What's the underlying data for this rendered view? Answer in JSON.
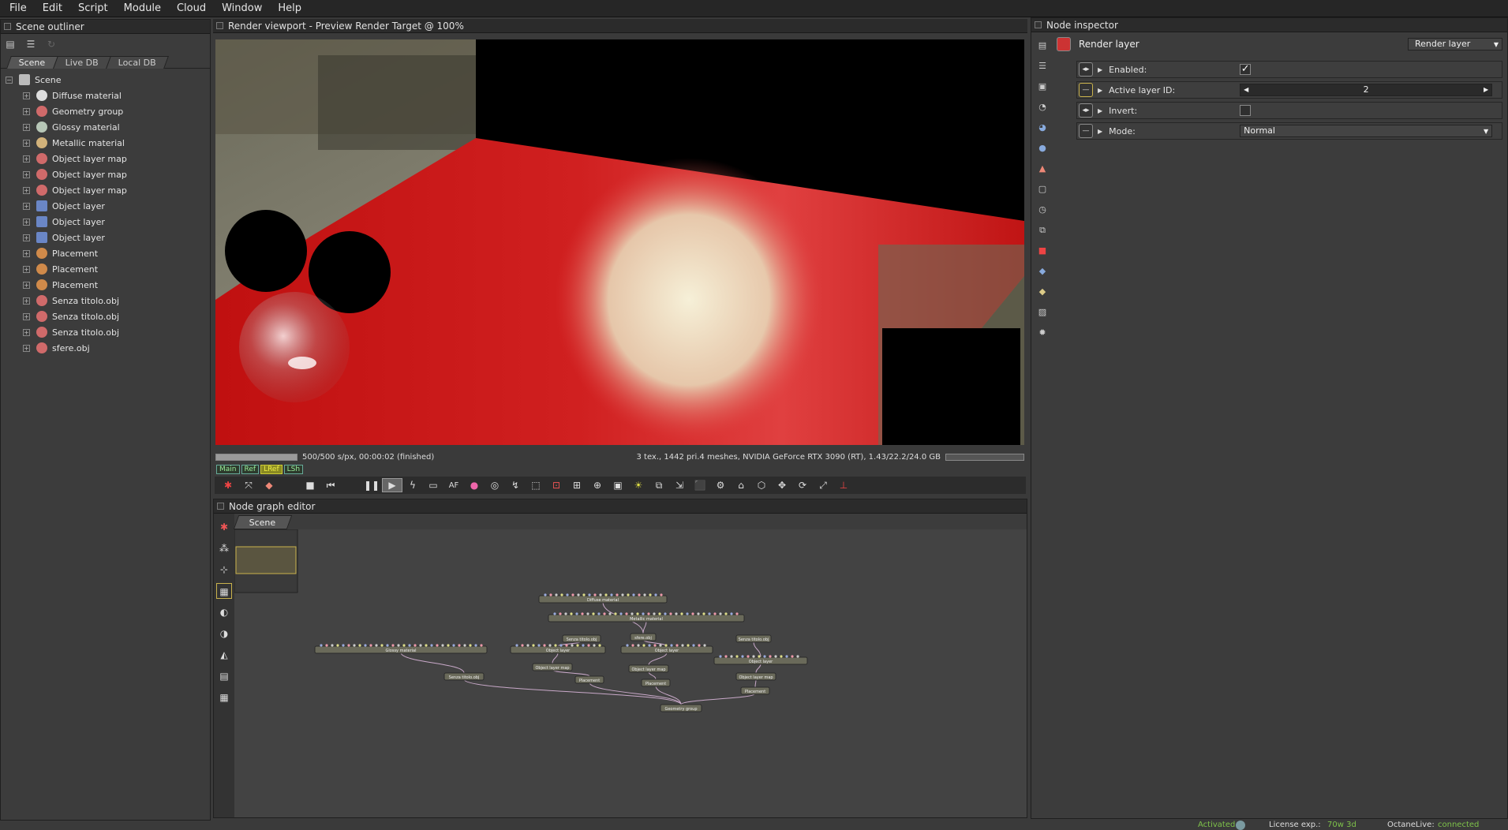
{
  "menu": [
    "File",
    "Edit",
    "Script",
    "Module",
    "Cloud",
    "Window",
    "Help"
  ],
  "outliner": {
    "title": "Scene outliner",
    "tabs": [
      "Scene",
      "Live DB",
      "Local DB"
    ],
    "items": [
      {
        "label": "Scene",
        "icon": "scene-icon",
        "color": "#bbbbbb"
      },
      {
        "label": "Diffuse material",
        "icon": "material-sphere-icon",
        "color": "#dddddd"
      },
      {
        "label": "Geometry group",
        "icon": "geometry-group-icon",
        "color": "#d06a6a"
      },
      {
        "label": "Glossy material",
        "icon": "material-sphere-icon",
        "color": "#b7c7b7"
      },
      {
        "label": "Metallic material",
        "icon": "material-sphere-icon",
        "color": "#d2b27a"
      },
      {
        "label": "Object layer map",
        "icon": "mesh-icon",
        "color": "#d06a6a"
      },
      {
        "label": "Object layer map",
        "icon": "mesh-icon",
        "color": "#d06a6a"
      },
      {
        "label": "Object layer map",
        "icon": "mesh-icon",
        "color": "#d06a6a"
      },
      {
        "label": "Object layer",
        "icon": "layer-grid-icon",
        "color": "#6a86c6"
      },
      {
        "label": "Object layer",
        "icon": "layer-grid-icon",
        "color": "#6a86c6"
      },
      {
        "label": "Object layer",
        "icon": "layer-grid-icon",
        "color": "#6a86c6"
      },
      {
        "label": "Placement",
        "icon": "placement-icon",
        "color": "#d08a4a"
      },
      {
        "label": "Placement",
        "icon": "placement-icon",
        "color": "#d08a4a"
      },
      {
        "label": "Placement",
        "icon": "placement-icon",
        "color": "#d08a4a"
      },
      {
        "label": "Senza titolo.obj",
        "icon": "mesh-icon",
        "color": "#d06a6a"
      },
      {
        "label": "Senza titolo.obj",
        "icon": "mesh-icon",
        "color": "#d06a6a"
      },
      {
        "label": "Senza titolo.obj",
        "icon": "mesh-icon",
        "color": "#d06a6a"
      },
      {
        "label": "sfere.obj",
        "icon": "mesh-icon",
        "color": "#d06a6a"
      }
    ]
  },
  "viewport": {
    "title": "Render viewport - Preview Render Target @ 100%",
    "progress_text": "500/500 s/px, 00:00:02 (finished)",
    "progress": 1.0,
    "stats_text": "3 tex., 1442 pri.4 meshes, NVIDIA GeForce RTX 3090 (RT), 1.43/22.2/24.0 GB",
    "passes": [
      "Main",
      "Ref",
      "LRef",
      "LSh"
    ],
    "active_pass": "LRef"
  },
  "nodegraph": {
    "title": "Node graph editor",
    "tab": "Scene",
    "nodes": [
      {
        "label": "Diffuse material"
      },
      {
        "label": "Metallic material"
      },
      {
        "label": "Glossy material"
      },
      {
        "label": "Senza titolo.obj"
      },
      {
        "label": "sfere.obj"
      },
      {
        "label": "Senza titolo.obj"
      },
      {
        "label": "Object layer"
      },
      {
        "label": "Object layer"
      },
      {
        "label": "Object layer"
      },
      {
        "label": "Object layer map"
      },
      {
        "label": "Object layer map"
      },
      {
        "label": "Object layer map"
      },
      {
        "label": "Senza titolo.obj"
      },
      {
        "label": "Placement"
      },
      {
        "label": "Placement"
      },
      {
        "label": "Placement"
      },
      {
        "label": "Geometry group"
      }
    ]
  },
  "inspector": {
    "title": "Node inspector",
    "node_name": "Render layer",
    "node_type": "Render layer",
    "params": {
      "enabled_label": "Enabled:",
      "enabled": true,
      "active_id_label": "Active layer ID:",
      "active_id": "2",
      "invert_label": "Invert:",
      "invert": false,
      "mode_label": "Mode:",
      "mode": "Normal"
    }
  },
  "status": {
    "activated": "Activated",
    "license_label": "License exp.:",
    "license_value": "70w 3d",
    "octanelive_label": "OctaneLive:",
    "octanelive_value": "connected",
    "ok_color": "#7ec24a"
  }
}
